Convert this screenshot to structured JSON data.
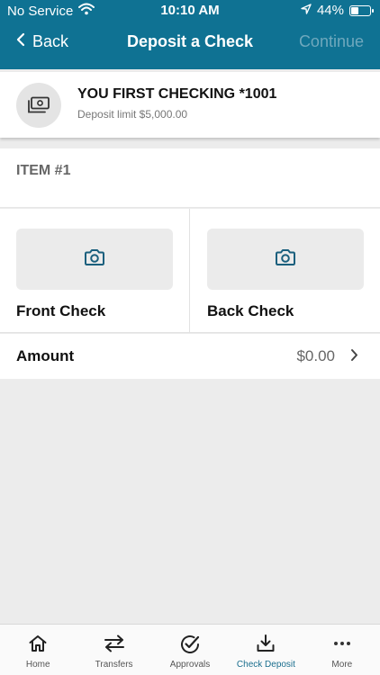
{
  "status_bar": {
    "carrier": "No Service",
    "time": "10:10 AM",
    "battery": "44%",
    "battery_level": 0.44
  },
  "nav": {
    "back_label": "Back",
    "title": "Deposit a Check",
    "continue_label": "Continue"
  },
  "account": {
    "name": "YOU FIRST CHECKING *1001",
    "limit": "Deposit limit $5,000.00"
  },
  "item": {
    "label": "ITEM #1",
    "front_label": "Front Check",
    "back_label": "Back Check"
  },
  "amount": {
    "label": "Amount",
    "value": "$0.00"
  },
  "tabs": [
    {
      "label": "Home",
      "icon": "home-icon"
    },
    {
      "label": "Transfers",
      "icon": "transfers-icon"
    },
    {
      "label": "Approvals",
      "icon": "approvals-icon"
    },
    {
      "label": "Check Deposit",
      "icon": "check-deposit-icon"
    },
    {
      "label": "More",
      "icon": "more-icon"
    }
  ],
  "active_tab": 3,
  "colors": {
    "header": "#0f7293",
    "active_tab": "#1a6e8e",
    "background": "#ececec"
  }
}
